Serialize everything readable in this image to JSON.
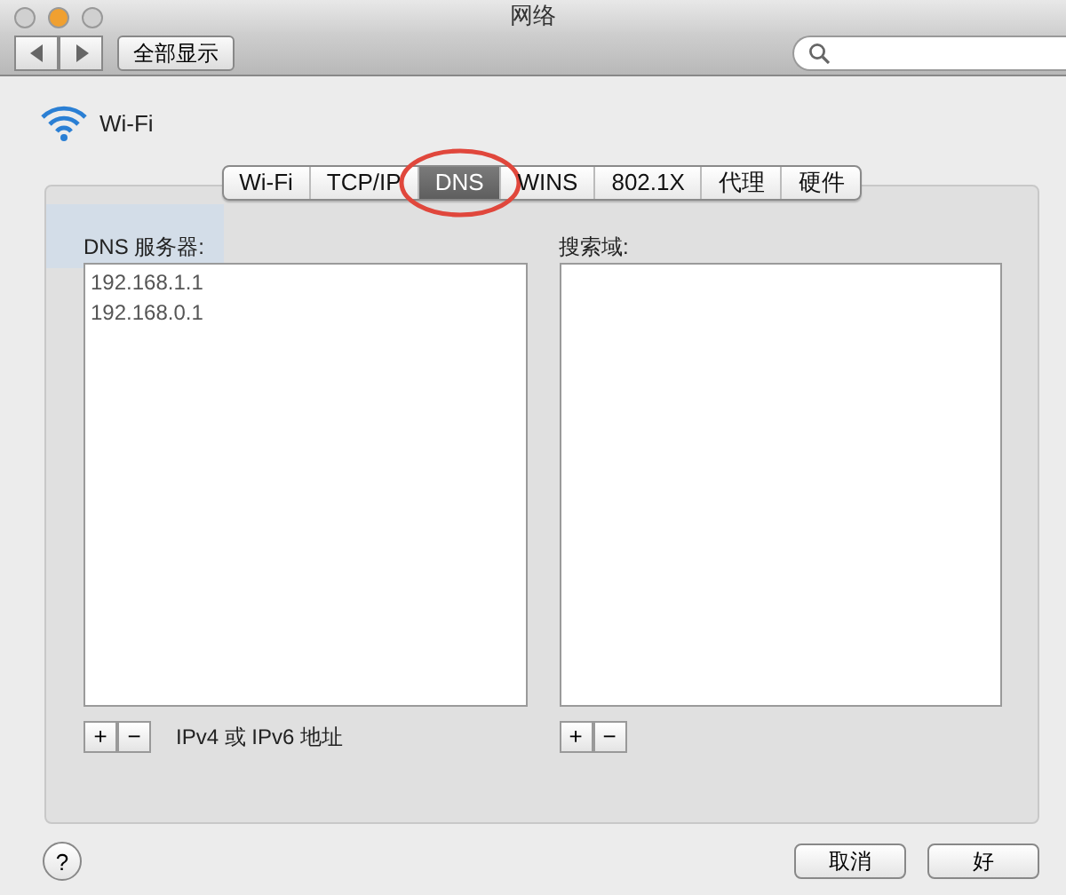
{
  "window": {
    "title": "网络"
  },
  "toolbar": {
    "show_all": "全部显示"
  },
  "service": {
    "name": "Wi-Fi"
  },
  "tabs": [
    {
      "label": "Wi-Fi",
      "selected": false,
      "circled": false
    },
    {
      "label": "TCP/IP",
      "selected": false,
      "circled": false
    },
    {
      "label": "DNS",
      "selected": true,
      "circled": true
    },
    {
      "label": "WINS",
      "selected": false,
      "circled": false
    },
    {
      "label": "802.1X",
      "selected": false,
      "circled": false
    },
    {
      "label": "代理",
      "selected": false,
      "circled": false
    },
    {
      "label": "硬件",
      "selected": false,
      "circled": false
    }
  ],
  "dns_servers": {
    "label": "DNS 服务器:",
    "entries": [
      "192.168.1.1",
      "192.168.0.1"
    ],
    "add": "+",
    "remove": "−",
    "hint": "IPv4 或 IPv6 地址"
  },
  "search_domains": {
    "label": "搜索域:",
    "add": "+",
    "remove": "−"
  },
  "help": "?",
  "buttons": [
    {
      "label": "取消"
    },
    {
      "label": "好"
    }
  ]
}
